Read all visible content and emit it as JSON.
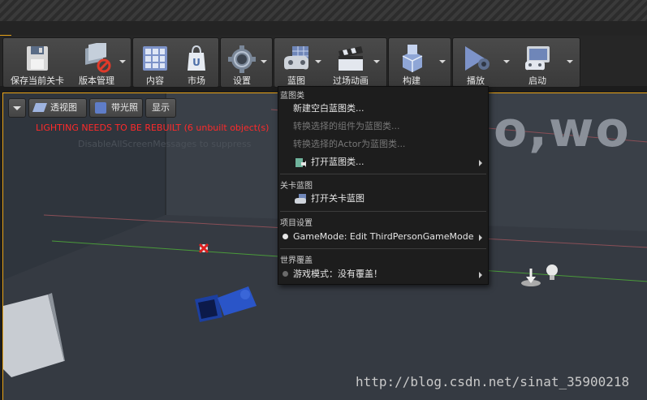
{
  "toolbar": {
    "save": "保存当前关卡",
    "source_control": "版本管理",
    "content": "内容",
    "marketplace": "市场",
    "settings": "设置",
    "blueprints": "蓝图",
    "cinematics": "过场动画",
    "build": "构建",
    "play": "播放",
    "launch": "启动"
  },
  "viewport": {
    "perspective": "透视图",
    "lit": "带光照",
    "show": "显示",
    "warning": "LIGHTING NEEDS TO BE REBUILT (6 unbuilt object(s)",
    "ghost_text": "DisableAllScreenMessages to suppress",
    "big_text": "o,wo",
    "watermark": "http://blog.csdn.net/sinat_35900218"
  },
  "blueprint_menu": {
    "section_classes": "蓝图类",
    "new_blueprint": "新建空白蓝图类...",
    "convert_components": "转换选择的组件为蓝图类...",
    "convert_actor": "转换选择的Actor为蓝图类...",
    "open_blueprint": "打开蓝图类...",
    "section_level": "关卡蓝图",
    "open_level_blueprint": "打开关卡蓝图",
    "section_project": "项目设置",
    "gamemode": "GameMode: Edit ThirdPersonGameMode",
    "section_world": "世界覆盖",
    "game_mode_override": "游戏模式：没有覆盖！"
  },
  "colors": {
    "accent": "#e8a317",
    "warning": "#ff2a2a",
    "menu_bg": "#1d1d1d"
  }
}
